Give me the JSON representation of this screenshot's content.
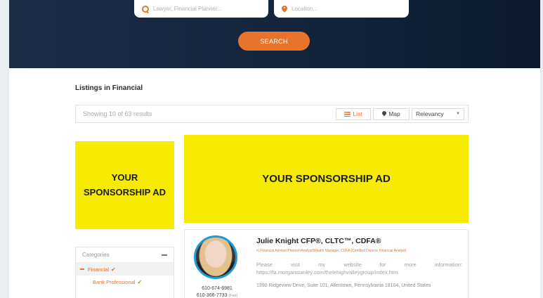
{
  "search": {
    "what_placeholder": "Lawyer, Financial Planner...",
    "where_placeholder": "Location...",
    "button_label": "SEARCH"
  },
  "listings": {
    "heading": "Listings in Financial",
    "result_count": "Showing 10 of 63 results",
    "view_list_label": "List",
    "view_map_label": "Map",
    "sort_selected": "Relevancy"
  },
  "ads": {
    "side_label": "YOUR SPONSORSHIP AD",
    "main_label": "YOUR SPONSORSHIP AD"
  },
  "categories": {
    "title": "Categories",
    "items": [
      {
        "label": "Financial",
        "checked": true
      },
      {
        "label": "Bank Professional",
        "checked": true
      }
    ]
  },
  "listing": {
    "name": "Julie Knight CFP®, CLTC™, CDFA®",
    "in_label": "in",
    "categories_text": "Financial Advisor/Planner/Analyst/Wealth Manager, CDFA (Certified Divorce Financial Analyst)",
    "description": "Please visit my website for more information: https://fa.morganstanley.com/thelehighvalleygroup/index.htm",
    "address": "1390 Ridgeview Drive, Suite 101, Allentown, Pennsylvania 18104, United States",
    "phone": "610-674-6981",
    "fax": "610-366-7733",
    "fax_label": "(Fax)"
  },
  "colors": {
    "accent": "#e8732a",
    "hero_bg": "#13243b",
    "ad_yellow": "#f7ec00",
    "avatar_ring": "#1e9bd7"
  }
}
